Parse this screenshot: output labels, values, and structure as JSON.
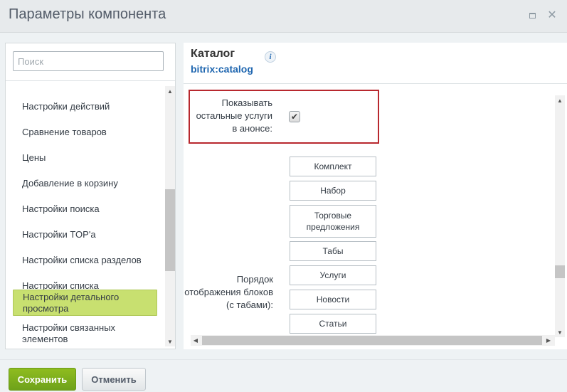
{
  "window": {
    "title": "Параметры компонента"
  },
  "sidebar": {
    "search_placeholder": "Поиск",
    "items": [
      {
        "label": "Настройки действий"
      },
      {
        "label": "Сравнение товаров"
      },
      {
        "label": "Цены"
      },
      {
        "label": "Добавление в корзину"
      },
      {
        "label": "Настройки поиска"
      },
      {
        "label": "Настройки TOP'а"
      },
      {
        "label": "Настройки списка разделов"
      },
      {
        "label": "Настройки списка"
      },
      {
        "label": "Настройки детального просмотра",
        "active": true
      },
      {
        "label": "Настройки связанных элементов"
      }
    ]
  },
  "component": {
    "name": "Каталог",
    "code": "bitrix:catalog",
    "info_icon": "info-icon"
  },
  "params": {
    "show_services": {
      "label": "Показывать остальные услуги в анонсе:",
      "checked": true
    },
    "block_order": {
      "label": "Порядок отображения блоков (с табами):",
      "items": [
        "Комплект",
        "Набор",
        "Торговые предложения",
        "Табы",
        "Услуги",
        "Новости",
        "Статьи"
      ]
    }
  },
  "footer": {
    "save_label": "Сохранить",
    "cancel_label": "Отменить"
  },
  "colors": {
    "active_item": "#c8e070",
    "highlight_border": "#b8282e",
    "save_button": "#7aae1c",
    "link_blue": "#2067b0"
  }
}
